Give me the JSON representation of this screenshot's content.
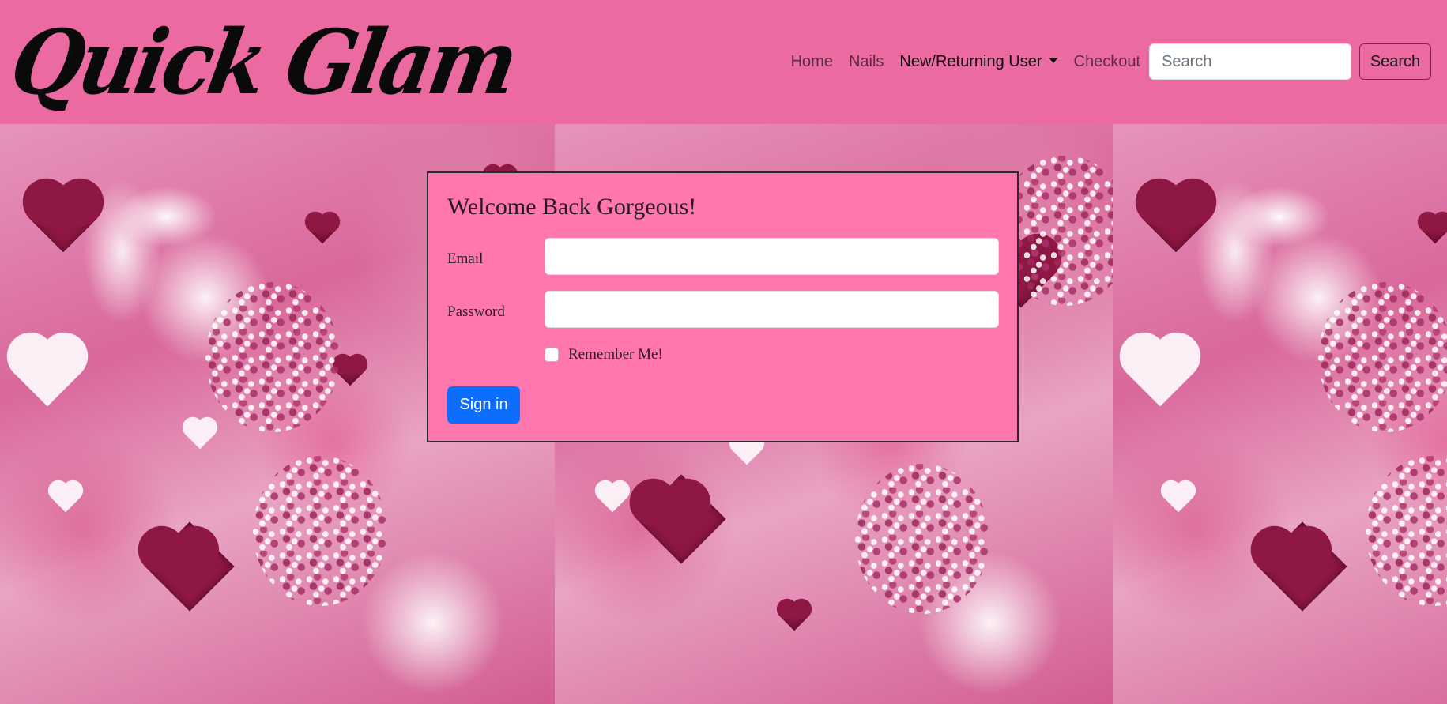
{
  "brand": {
    "name": "Quick Glam"
  },
  "nav": {
    "links": [
      {
        "label": "Home"
      },
      {
        "label": "Nails"
      },
      {
        "label": "New/Returning User"
      },
      {
        "label": "Checkout"
      }
    ],
    "search_placeholder": "Search",
    "search_button": "Search"
  },
  "login": {
    "title": "Welcome Back Gorgeous!",
    "email_label": "Email",
    "email_value": "",
    "password_label": "Password",
    "password_value": "",
    "remember_label": "Remember Me!",
    "remember_checked": false,
    "submit_label": "Sign in"
  },
  "colors": {
    "navbar_bg": "#ea6aa1",
    "card_bg": "#ff77ae",
    "primary_button": "#0d6efd"
  }
}
